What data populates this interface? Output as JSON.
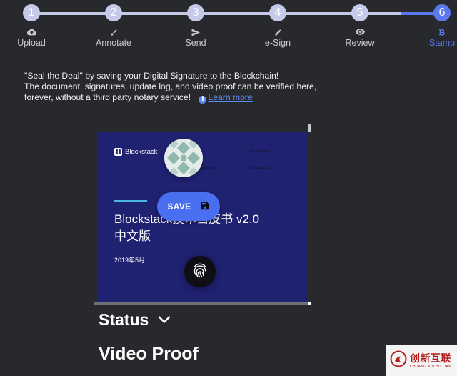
{
  "stepper": {
    "accent_color": "#5b78f0",
    "inactive_color": "#c5cae9",
    "current_step": 6,
    "steps": [
      {
        "number": "1",
        "label": "Upload",
        "icon": "cloud-upload-icon"
      },
      {
        "number": "2",
        "label": "Annotate",
        "icon": "brush-icon"
      },
      {
        "number": "3",
        "label": "Send",
        "icon": "send-icon"
      },
      {
        "number": "4",
        "label": "e-Sign",
        "icon": "pencil-icon"
      },
      {
        "number": "5",
        "label": "Review",
        "icon": "eye-icon"
      },
      {
        "number": "6",
        "label": "Stamp",
        "icon": "bitcoin-icon"
      }
    ]
  },
  "intro": {
    "line1": "\"Seal the Deal\" by saving your Digital Signature to the Blockchain!",
    "line2": "The document, signatures, update log, and video proof can be verified here,",
    "line3": "forever, without a third party notary service!",
    "learn_more": "Learn more"
  },
  "document": {
    "logo_text": "Blockstack",
    "signature_1": "Blockstack",
    "signature_2": "Blockstack",
    "signature_3": "[Name]",
    "title_line1": "Blockstack技术白皮书 v2.0",
    "title_line2": "中文版",
    "date": "2019年5月",
    "background_color": "#1f2171"
  },
  "save_button": {
    "label": "SAVE",
    "icon": "floppy-disk-icon"
  },
  "fingerprint_button": {
    "icon": "fingerprint-icon"
  },
  "status_section": {
    "label": "Status",
    "icon": "chevron-down-icon"
  },
  "video_section": {
    "label": "Video Proof"
  },
  "watermark": {
    "text_cn": "创新互联",
    "text_en": "CHUANG XIN HU LIAN"
  }
}
